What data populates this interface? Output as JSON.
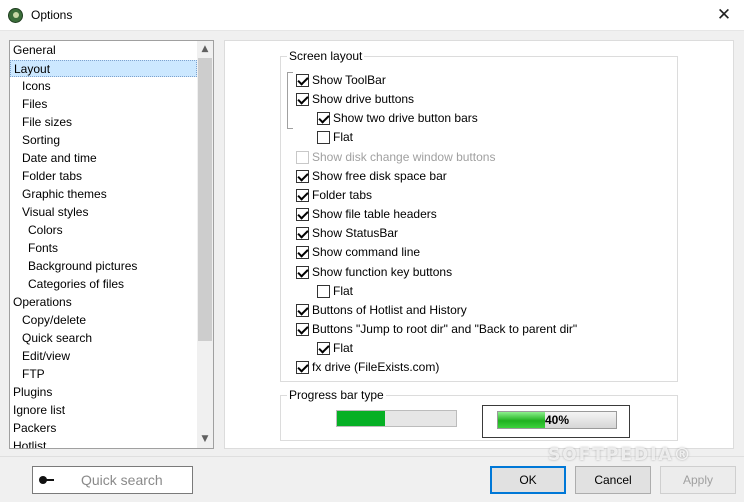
{
  "window": {
    "title": "Options",
    "close_glyph": "✕"
  },
  "tree": {
    "items": [
      {
        "label": "General",
        "indent": 0
      },
      {
        "label": "Layout",
        "indent": 0,
        "selected": true
      },
      {
        "label": "Icons",
        "indent": 1
      },
      {
        "label": "Files",
        "indent": 1
      },
      {
        "label": "File sizes",
        "indent": 1
      },
      {
        "label": "Sorting",
        "indent": 1
      },
      {
        "label": "Date and time",
        "indent": 1
      },
      {
        "label": "Folder tabs",
        "indent": 1
      },
      {
        "label": "Graphic themes",
        "indent": 1
      },
      {
        "label": "Visual styles",
        "indent": 1
      },
      {
        "label": "Colors",
        "indent": 2
      },
      {
        "label": "Fonts",
        "indent": 2
      },
      {
        "label": "Background pictures",
        "indent": 2
      },
      {
        "label": "Categories of files",
        "indent": 2
      },
      {
        "label": "Operations",
        "indent": 0
      },
      {
        "label": "Copy/delete",
        "indent": 1
      },
      {
        "label": "Quick search",
        "indent": 1
      },
      {
        "label": "Edit/view",
        "indent": 1
      },
      {
        "label": "FTP",
        "indent": 1
      },
      {
        "label": "Plugins",
        "indent": 0
      },
      {
        "label": "Ignore list",
        "indent": 0
      },
      {
        "label": "Packers",
        "indent": 0
      },
      {
        "label": "Hotlist",
        "indent": 0
      }
    ],
    "scroll_up_glyph": "▲",
    "scroll_down_glyph": "▼"
  },
  "screen_layout": {
    "legend": "Screen layout",
    "options": [
      {
        "id": "show-toolbar",
        "label": "Show ToolBar",
        "checked": true,
        "indent": 0
      },
      {
        "id": "show-drive-buttons",
        "label": "Show drive buttons",
        "checked": true,
        "indent": 0
      },
      {
        "id": "show-two-drive-button-bars",
        "label": "Show two drive button bars",
        "checked": true,
        "indent": 1
      },
      {
        "id": "drive-buttons-flat",
        "label": "Flat",
        "checked": false,
        "indent": 1
      },
      {
        "id": "show-disk-change-window-buttons",
        "label": "Show disk change window buttons",
        "checked": false,
        "indent": 0,
        "disabled": true
      },
      {
        "id": "show-free-disk-space-bar",
        "label": "Show free disk space bar",
        "checked": true,
        "indent": 0
      },
      {
        "id": "folder-tabs",
        "label": "Folder tabs",
        "checked": true,
        "indent": 0
      },
      {
        "id": "show-file-table-headers",
        "label": "Show file table headers",
        "checked": true,
        "indent": 0
      },
      {
        "id": "show-statusbar",
        "label": "Show StatusBar",
        "checked": true,
        "indent": 0
      },
      {
        "id": "show-command-line",
        "label": "Show command line",
        "checked": true,
        "indent": 0
      },
      {
        "id": "show-function-key-buttons",
        "label": "Show function key buttons",
        "checked": true,
        "indent": 0
      },
      {
        "id": "function-keys-flat",
        "label": "Flat",
        "checked": false,
        "indent": 1
      },
      {
        "id": "buttons-hotlist-history",
        "label": "Buttons of Hotlist and History",
        "checked": true,
        "indent": 0
      },
      {
        "id": "buttons-jump-root-parent",
        "label": "Buttons \"Jump to root dir\" and \"Back to parent dir\"",
        "checked": true,
        "indent": 0
      },
      {
        "id": "jump-buttons-flat",
        "label": "Flat",
        "checked": true,
        "indent": 1
      },
      {
        "id": "fx-drive",
        "label": "fx drive (FileExists.com)",
        "checked": true,
        "indent": 0
      }
    ]
  },
  "progress_bar_type": {
    "legend": "Progress bar type",
    "simple_progress": 0.4,
    "styled_progress": 0.4,
    "styled_label": "40%"
  },
  "footer": {
    "quick_search_placeholder": "Quick search",
    "ok_label": "OK",
    "cancel_label": "Cancel",
    "apply_label": "Apply"
  },
  "watermark": "SOFTPEDIA®",
  "colors": {
    "selection": "#cce8ff",
    "progress_green": "#06b025",
    "default_button_border": "#0078d7"
  }
}
